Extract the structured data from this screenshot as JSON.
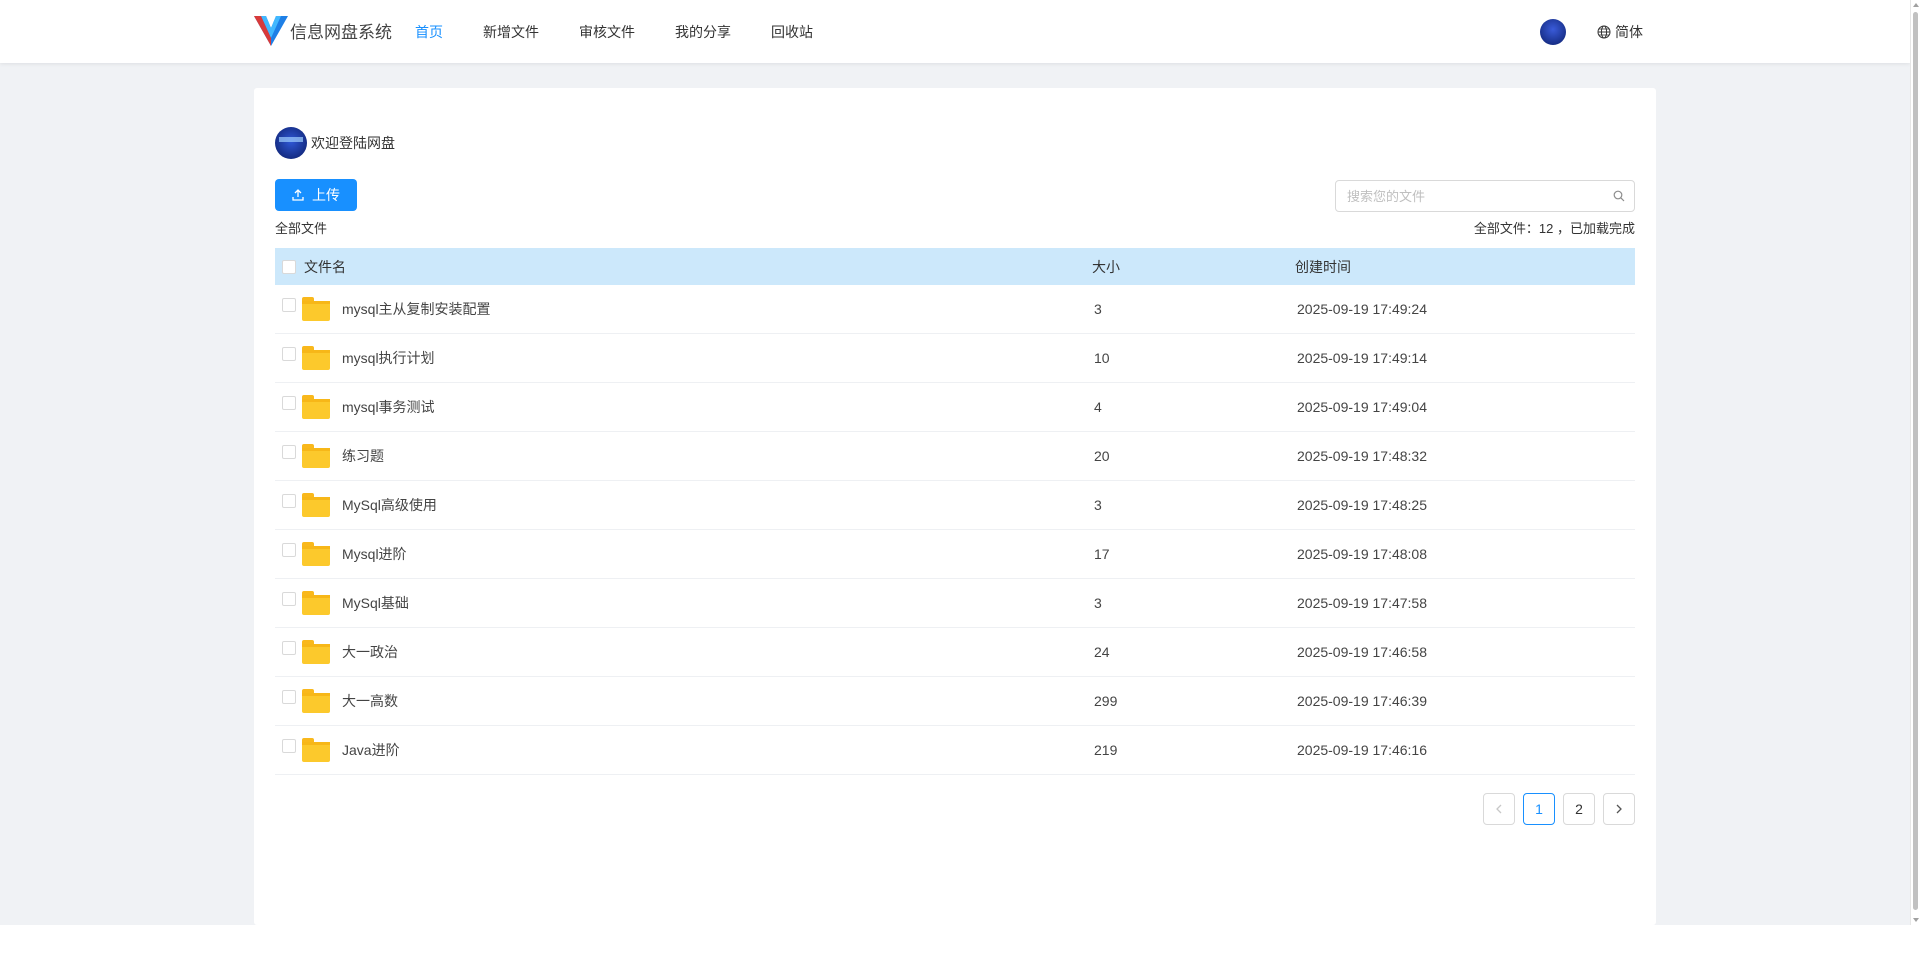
{
  "header": {
    "app_title": "信息网盘系统",
    "nav": [
      {
        "label": "首页",
        "active": true
      },
      {
        "label": "新增文件",
        "active": false
      },
      {
        "label": "审核文件",
        "active": false
      },
      {
        "label": "我的分享",
        "active": false
      },
      {
        "label": "回收站",
        "active": false
      }
    ],
    "language_label": "简体",
    "accent_color": "#1890ff"
  },
  "main": {
    "welcome_text": "欢迎登陆网盘",
    "upload_label": "上传",
    "breadcrumb": "全部文件",
    "search_placeholder": "搜索您的文件",
    "file_count_text": "全部文件：12 ，已加载完成",
    "columns": [
      "文件名",
      "大小",
      "创建时间"
    ],
    "rows": [
      {
        "name": "mysql主从复制安装配置",
        "size": "3",
        "created": "2025-09-19 17:49:24"
      },
      {
        "name": "mysql执行计划",
        "size": "10",
        "created": "2025-09-19 17:49:14"
      },
      {
        "name": "mysql事务测试",
        "size": "4",
        "created": "2025-09-19 17:49:04"
      },
      {
        "name": "练习题",
        "size": "20",
        "created": "2025-09-19 17:48:32"
      },
      {
        "name": "MySql高级使用",
        "size": "3",
        "created": "2025-09-19 17:48:25"
      },
      {
        "name": "Mysql进阶",
        "size": "17",
        "created": "2025-09-19 17:48:08"
      },
      {
        "name": "MySql基础",
        "size": "3",
        "created": "2025-09-19 17:47:58"
      },
      {
        "name": "大一政治",
        "size": "24",
        "created": "2025-09-19 17:46:58"
      },
      {
        "name": "大一高数",
        "size": "299",
        "created": "2025-09-19 17:46:39"
      },
      {
        "name": "Java进阶",
        "size": "219",
        "created": "2025-09-19 17:46:16"
      }
    ],
    "pagination": {
      "pages": [
        "1",
        "2"
      ],
      "current": "1"
    }
  }
}
